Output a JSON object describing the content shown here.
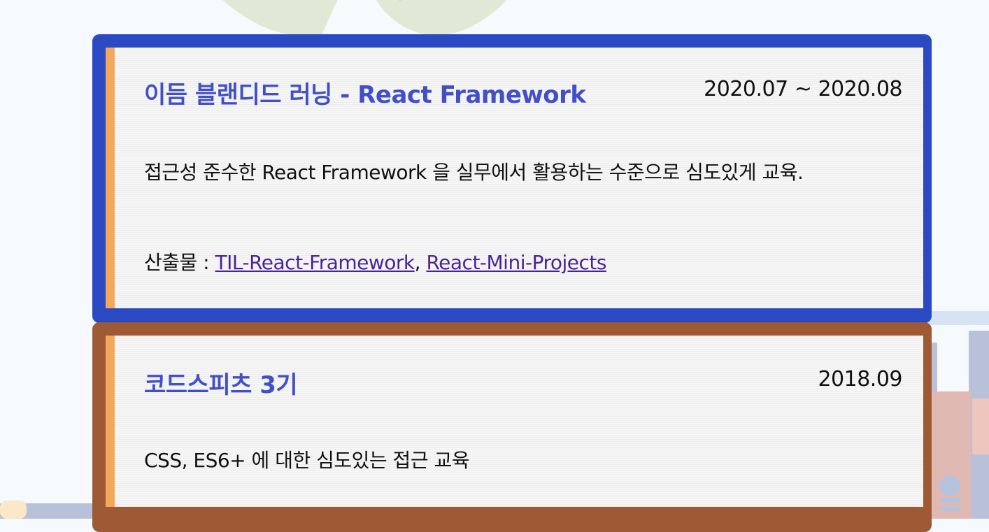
{
  "experiences": [
    {
      "title": "이듬 블랜디드 러닝 - React Framework",
      "period": "2020.07 ~ 2020.08",
      "description": "접근성 준수한 React Framework 을 실무에서 활용하는 수준으로 심도있게 교육.",
      "outputs_label": "산출물 : ",
      "outputs": [
        {
          "label": "TIL-React-Framework"
        },
        {
          "label": "React-Mini-Projects"
        }
      ],
      "outputs_separator": ", "
    },
    {
      "title": "코드스피츠 3기",
      "period": "2018.09",
      "description": "CSS, ES6+ 에 대한 심도있는 접근 교육"
    }
  ],
  "colors": {
    "card1_frame": "#2c49c4",
    "card2_frame": "#9e5a34",
    "accent_bar": "#f2a95c",
    "title": "#4250c8",
    "link": "#4a2398"
  }
}
